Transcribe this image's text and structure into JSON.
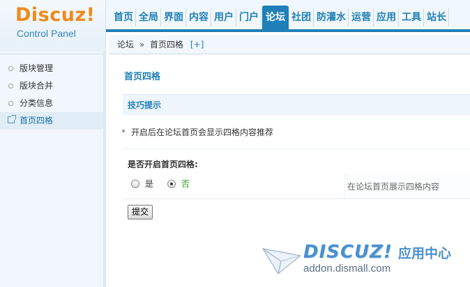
{
  "logo": {
    "brand": "Discuz!",
    "subtitle": "Control Panel"
  },
  "nav": {
    "items": [
      {
        "label": "首页"
      },
      {
        "label": "全局"
      },
      {
        "label": "界面"
      },
      {
        "label": "内容"
      },
      {
        "label": "用户"
      },
      {
        "label": "门户"
      },
      {
        "label": "论坛",
        "active": true
      },
      {
        "label": "社团"
      },
      {
        "label": "防灌水"
      },
      {
        "label": "运营"
      },
      {
        "label": "应用"
      },
      {
        "label": "工具"
      },
      {
        "label": "站长"
      }
    ]
  },
  "breadcrumb": {
    "root": "论坛",
    "separator": "»",
    "current": "首页四格",
    "add": "[+]"
  },
  "sidebar": {
    "items": [
      {
        "label": "版块管理"
      },
      {
        "label": "版块合并"
      },
      {
        "label": "分类信息"
      },
      {
        "label": "首页四格",
        "active": true
      }
    ]
  },
  "main": {
    "title": "首页四格",
    "tips_title": "技巧提示",
    "tip": "开启后在论坛首页会显示四格内容推荐",
    "setting_label": "是否开启首页四格:",
    "option_yes": "是",
    "option_no": "否",
    "selected": "否",
    "setting_desc": "在论坛首页展示四格内容",
    "submit_label": "提交"
  },
  "watermark": {
    "word": "DISCUZ!",
    "cn": "应用中心",
    "url": "addon.dismall.com"
  },
  "colors": {
    "accent": "#1f7fb8",
    "logo": "#f08a1b",
    "green": "#2a9a10"
  }
}
